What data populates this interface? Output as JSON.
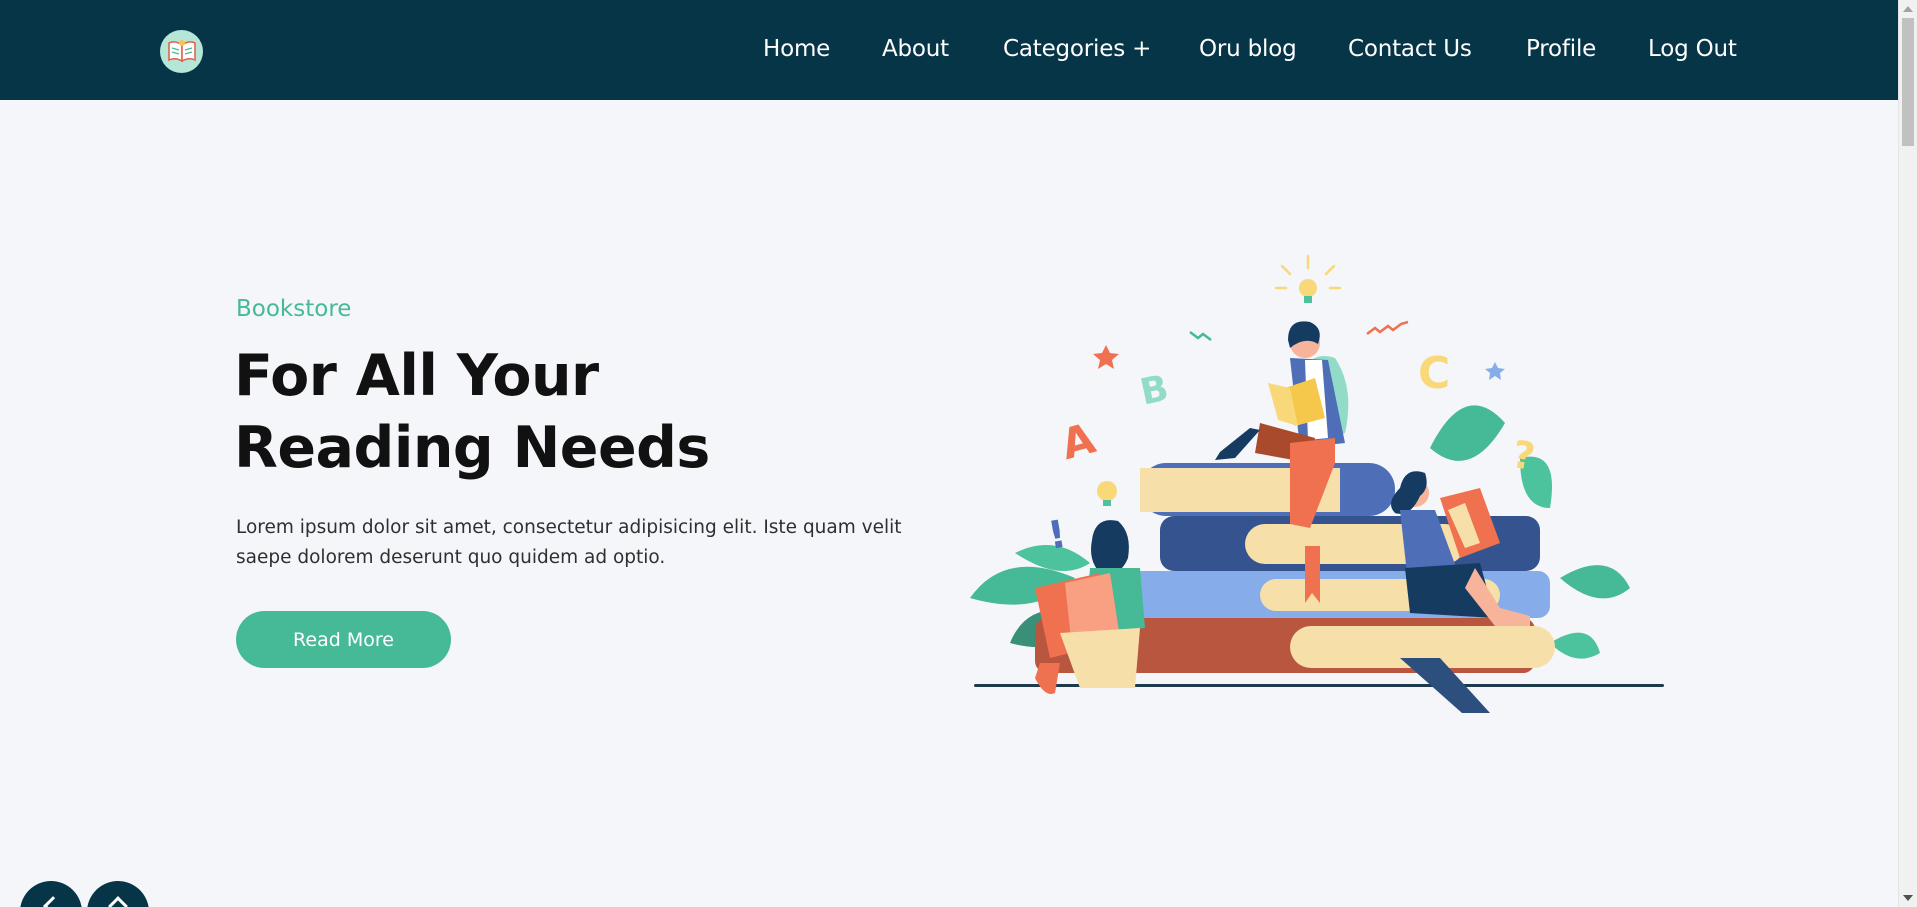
{
  "nav": {
    "logo_icon": "open-book-icon",
    "items": [
      {
        "label": "Home"
      },
      {
        "label": "About"
      },
      {
        "label": "Categories +"
      },
      {
        "label": "Oru blog"
      },
      {
        "label": "Contact Us"
      },
      {
        "label": "Profile"
      },
      {
        "label": "Log Out"
      }
    ]
  },
  "hero": {
    "eyebrow": "Bookstore",
    "headline_line1": "For All Your",
    "headline_line2": "Reading Needs",
    "description": "Lorem ipsum dolor sit amet, consectetur adipisicing elit. Iste quam velit saepe dolorem deserunt quo quidem ad optio.",
    "button_label": "Read More",
    "illustration": {
      "icon": "people-reading-on-books-illustration",
      "letters": [
        "A",
        "B",
        "C",
        "!",
        "?"
      ]
    }
  },
  "floating_buttons": [
    {
      "icon": "chevron-left-icon"
    },
    {
      "icon": "chevron-up-icon"
    }
  ],
  "colors": {
    "nav_bg": "#063547",
    "accent": "#46b996",
    "page_bg": "#f4f6fa",
    "heading": "#111111"
  }
}
